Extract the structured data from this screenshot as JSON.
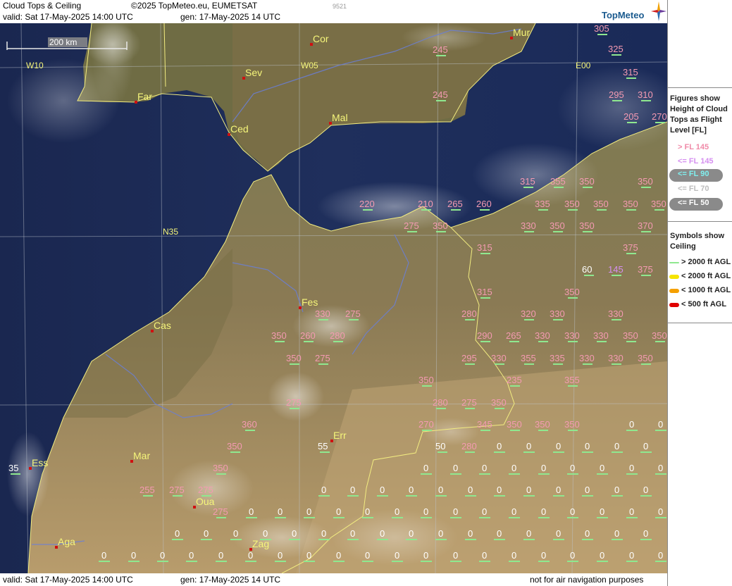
{
  "header": {
    "title": "Cloud Tops & Ceiling",
    "copyright": "©2025 TopMeteo.eu, EUMETSAT",
    "valid": "valid:  Sat  17-May-2025  14:00 UTC",
    "gen": "gen: 17-May-2025 14 UTC",
    "code": "9521",
    "logo": "TopMeteo"
  },
  "footer": {
    "valid": "valid:  Sat  17-May-2025  14:00 UTC",
    "gen": "gen: 17-May-2025 14 UTC",
    "disclaimer": "not for air navigation purposes"
  },
  "scale": "200 km",
  "grid_labels": [
    "W10",
    "W05",
    "E00",
    "N35"
  ],
  "cities": [
    "Cor",
    "Mur",
    "Sev",
    "Far",
    "Ced",
    "Mal",
    "Fes",
    "Cas",
    "Err",
    "Mar",
    "Ess",
    "Oua",
    "Aga",
    "Zag"
  ],
  "legend": {
    "tops_title": "Figures show Height of Cloud Tops as Flight Level  [FL]",
    "tops_items": [
      {
        "label": "> FL 145",
        "color": "#f08aa8"
      },
      {
        "label": "<= FL 145",
        "color": "#d58ff0"
      },
      {
        "label": "<= FL 90",
        "color": "#7ff0f0"
      },
      {
        "label": "<= FL 70",
        "color": "#bdbdbd"
      },
      {
        "label": "<= FL 50",
        "color": "#ffffff"
      }
    ],
    "ceiling_title": "Symbols show Ceiling",
    "ceiling_items": [
      {
        "label": "> 2000 ft AGL",
        "color": "#8fe88f"
      },
      {
        "label": "< 2000 ft AGL",
        "color": "#f5e400"
      },
      {
        "label": "< 1000 ft AGL",
        "color": "#f5a000"
      },
      {
        "label": "< 500 ft AGL",
        "color": "#e00000"
      }
    ]
  },
  "cloud_tops": {
    "pink": [
      "305",
      "325",
      "315",
      "295",
      "310",
      "205",
      "270",
      "245",
      "245",
      "315",
      "355",
      "350",
      "350",
      "335",
      "350",
      "350",
      "350",
      "350",
      "220",
      "210",
      "265",
      "260",
      "275",
      "350",
      "330",
      "350",
      "350",
      "370",
      "315",
      "375",
      "375",
      "315",
      "350",
      "275",
      "280",
      "320",
      "330",
      "330",
      "350",
      "260",
      "280",
      "290",
      "265",
      "330",
      "330",
      "330",
      "350",
      "350",
      "350",
      "275",
      "295",
      "330",
      "355",
      "335",
      "330",
      "330",
      "350",
      "350",
      "235",
      "355",
      "330",
      "280",
      "275",
      "350",
      "360",
      "270",
      "345",
      "350",
      "350",
      "350",
      "350",
      "280",
      "350",
      "255",
      "275",
      "275",
      "275",
      "275"
    ],
    "white": [
      "60",
      "55",
      "50",
      "35"
    ],
    "purple": [
      "145"
    ],
    "zero": "0"
  }
}
